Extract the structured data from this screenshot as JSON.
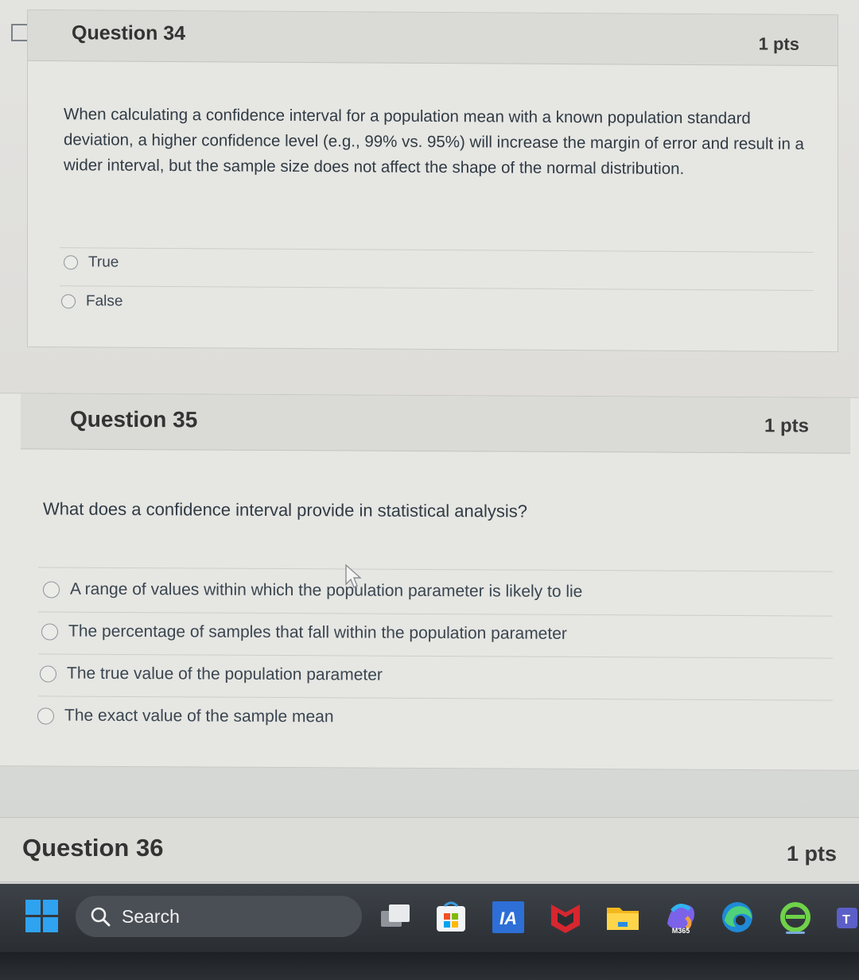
{
  "q34": {
    "title": "Question 34",
    "points": "1 pts",
    "text": "When calculating a confidence interval for a population mean with a known population standard deviation, a higher confidence level (e.g., 99% vs. 95%) will increase the margin of error and result in a wider interval, but the sample size does not affect the shape of the normal distribution.",
    "answers": [
      "True",
      "False"
    ]
  },
  "q35": {
    "title": "Question 35",
    "points": "1 pts",
    "text": "What does a confidence interval provide in statistical analysis?",
    "answers": [
      "A range of values within which the population parameter is likely to lie",
      "The percentage of samples that fall within the population parameter",
      "The true value of the population parameter",
      "The exact value of the sample mean"
    ]
  },
  "q36": {
    "title": "Question 36",
    "points": "1 pts"
  },
  "taskbar": {
    "search_label": "Search",
    "icons": [
      "windows-start-icon",
      "search-icon",
      "task-view-icon",
      "microsoft-store-icon",
      "ia-app-icon",
      "mcafee-icon",
      "file-explorer-icon",
      "m365-copilot-icon",
      "edge-icon",
      "ie-app-icon",
      "teams-icon"
    ],
    "m365_label": "M365"
  }
}
